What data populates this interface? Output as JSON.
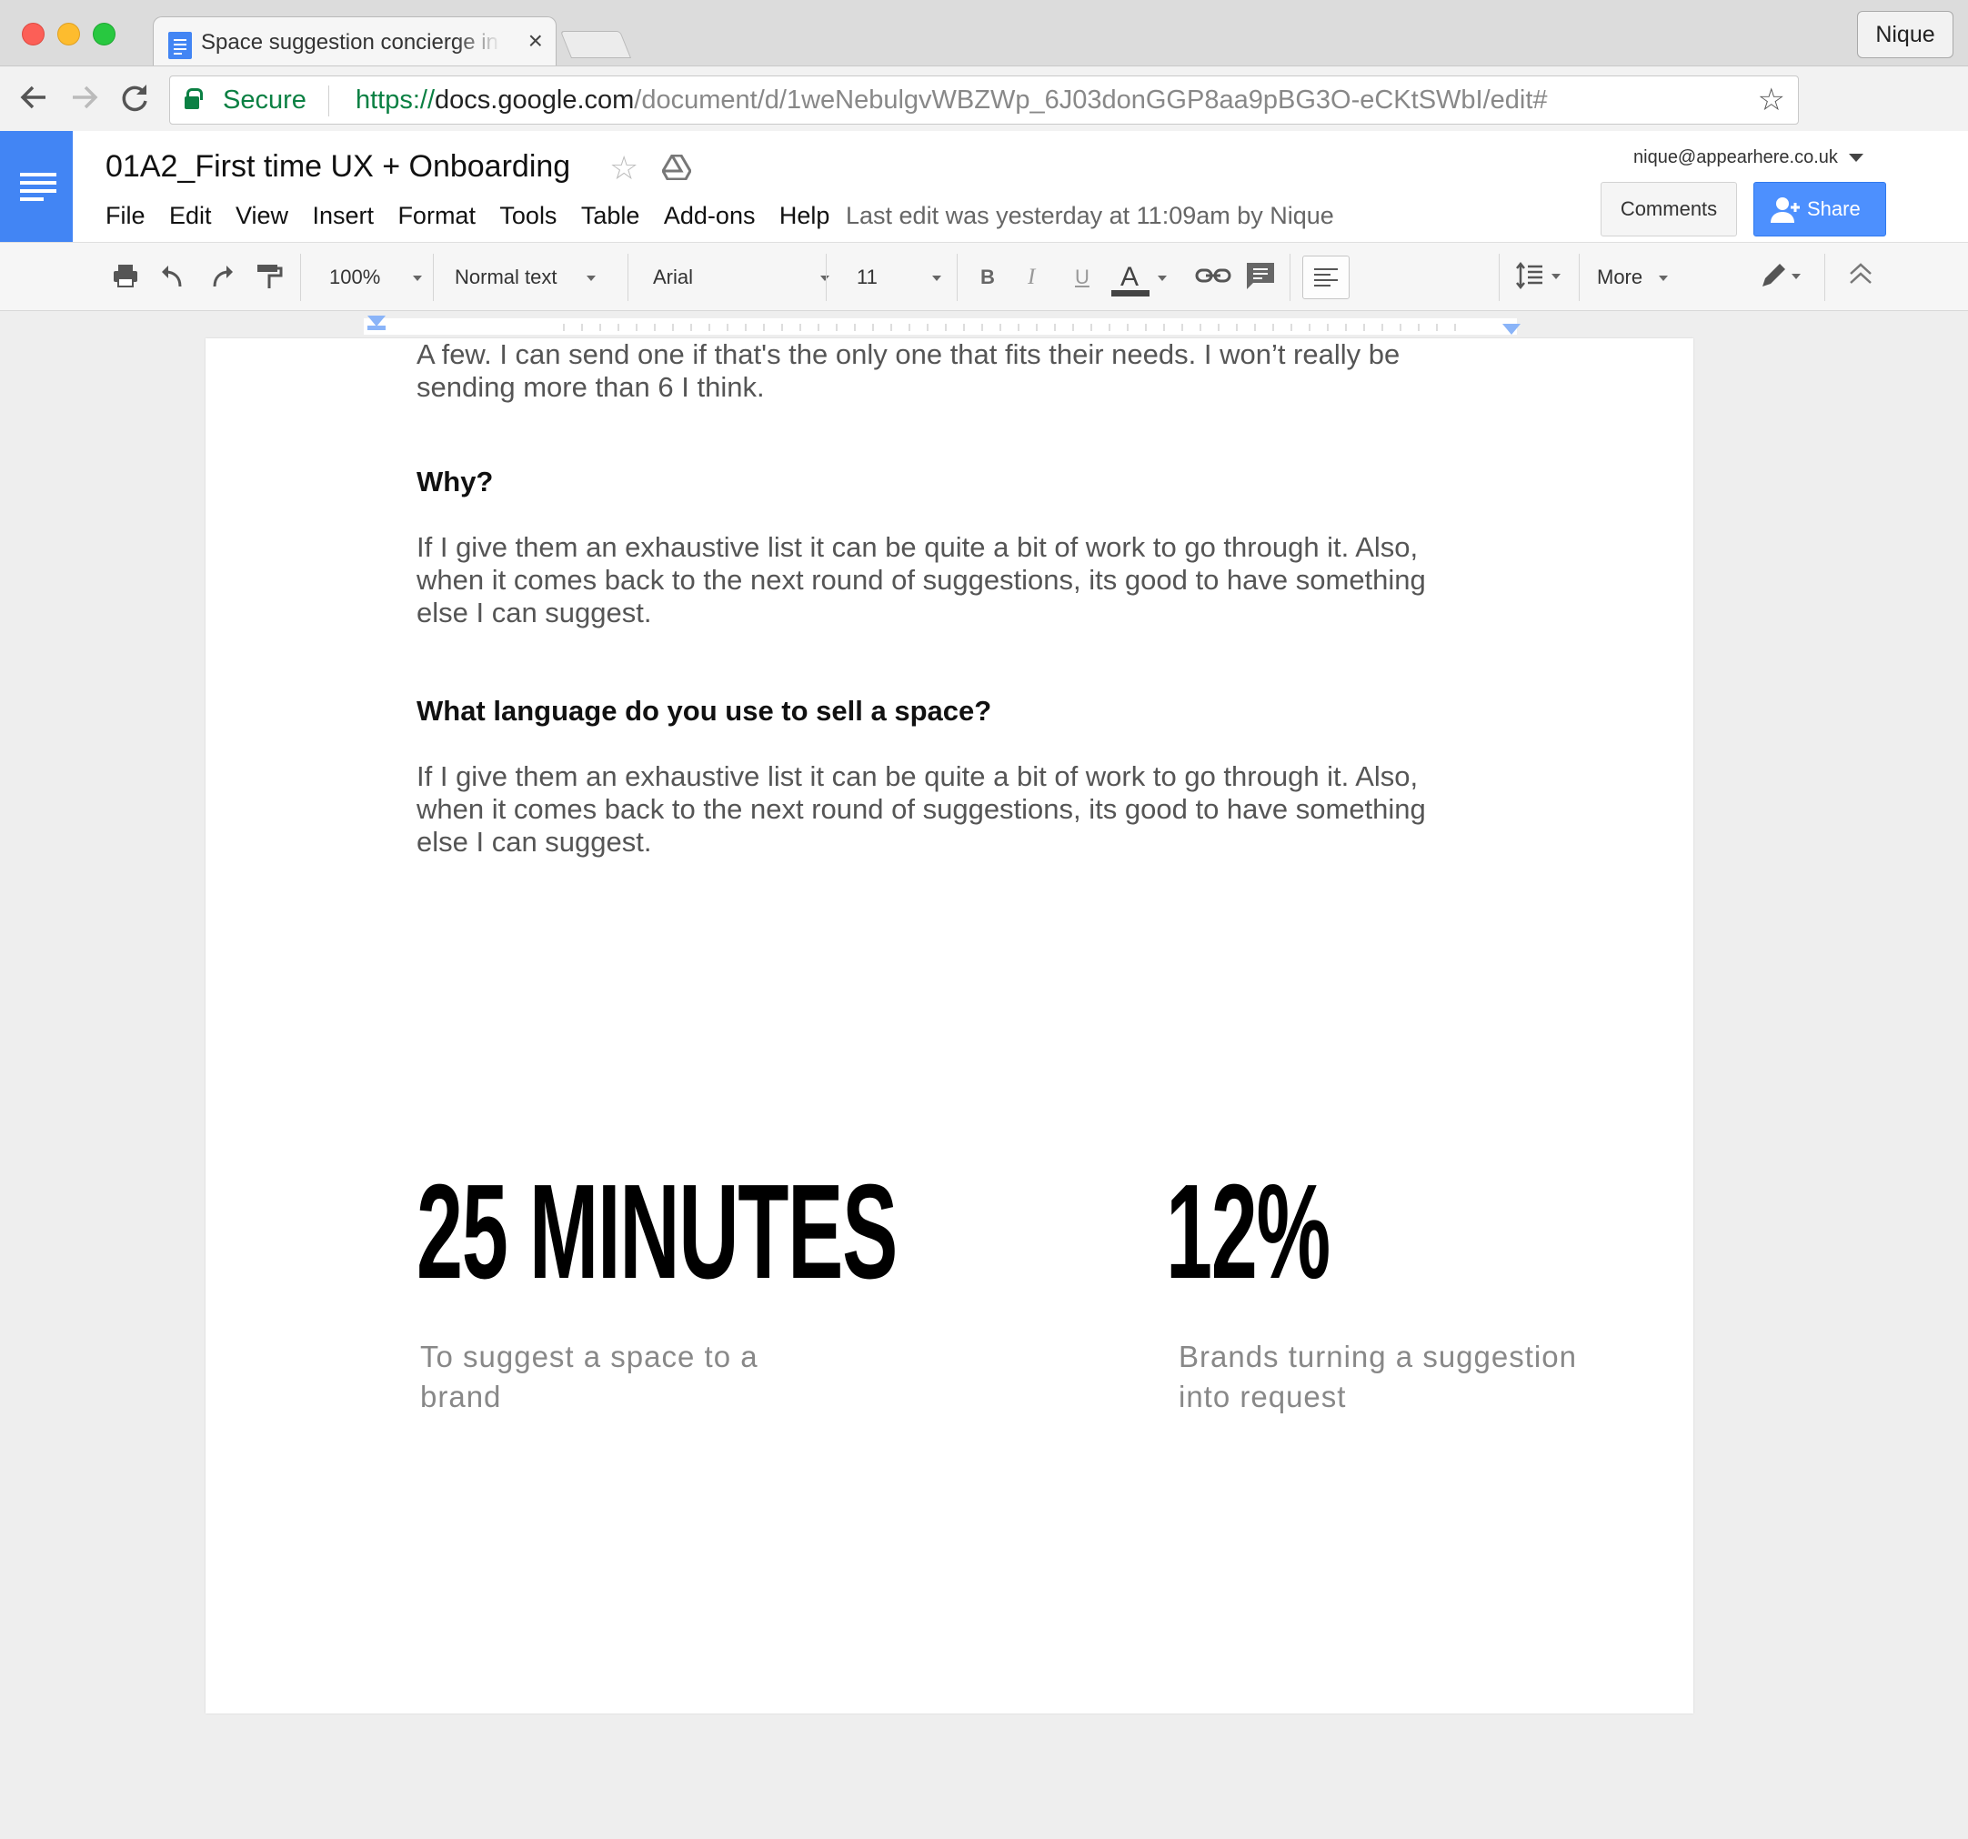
{
  "browser": {
    "tab_title": "Space suggestion concierge in",
    "tab_close": "×",
    "profile_name": "Nique",
    "secure_label": "Secure",
    "url_scheme": "https://",
    "url_host": "docs.google.com",
    "url_path": "/document/d/1weNebulgvWBZWp_6J03donGGP8aa9pBG3O-eCKtSWbI/edit#"
  },
  "docs": {
    "title": "01A2_First time UX + Onboarding",
    "menu": [
      "File",
      "Edit",
      "View",
      "Insert",
      "Format",
      "Tools",
      "Table",
      "Add-ons",
      "Help"
    ],
    "last_edit": "Last edit was yesterday at 11:09am by Nique",
    "account_email": "nique@appearhere.co.uk",
    "comments_label": "Comments",
    "share_label": "Share"
  },
  "toolbar": {
    "zoom": "100%",
    "style": "Normal text",
    "font": "Arial",
    "size": "11",
    "bold": "B",
    "italic": "I",
    "underline": "U",
    "text_color": "A",
    "more": "More"
  },
  "document": {
    "p1": "A few.  I can send one if that's the only one that fits their needs.  I won’t really be sending more than 6 I think.",
    "h1": "Why?",
    "p2": "If I give them an exhaustive list it can be quite a bit of work to go through it.  Also, when it comes back to the next round of suggestions, its good to have something else I can suggest.",
    "h2": "What language do you use to sell a space?",
    "p3": "If I give them an exhaustive list it can be quite a bit of work to go through it.  Also, when it comes back to the next round of suggestions, its good to have something else I can suggest.",
    "stat1_value": "25 MINUTES",
    "stat1_caption": "To suggest a space to a brand",
    "stat2_value": "12%",
    "stat2_caption": "Brands turning a suggestion into request"
  },
  "colors": {
    "docs_blue": "#4285f4",
    "share_blue": "#4d90fe",
    "secure_green": "#0b8043"
  }
}
